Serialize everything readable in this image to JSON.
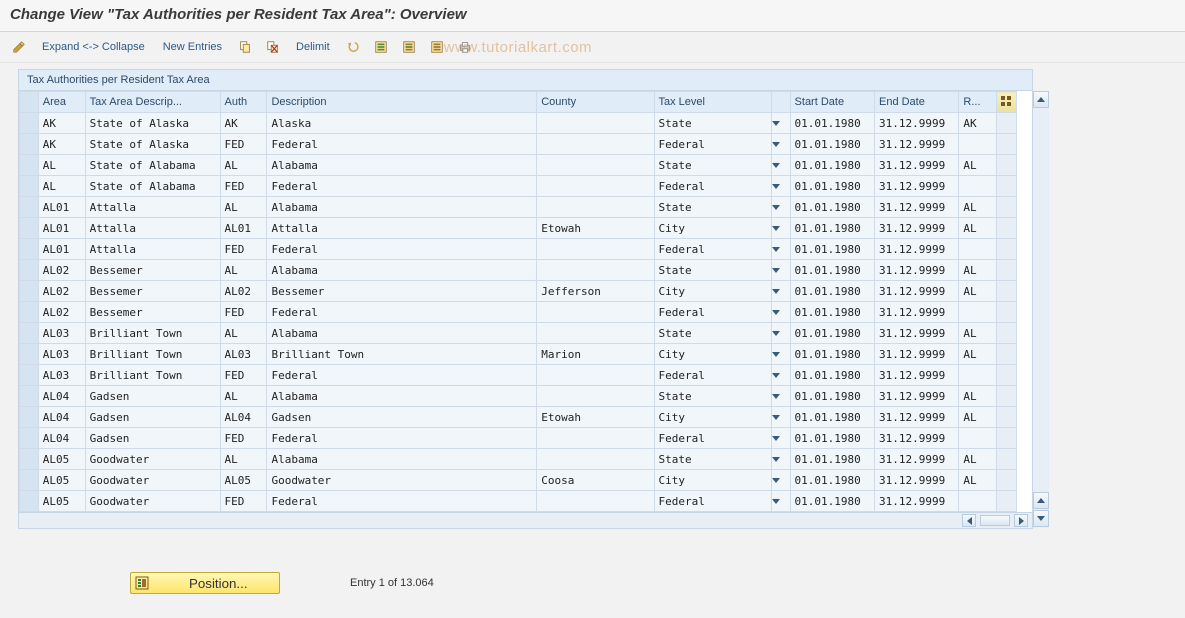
{
  "title": "Change View \"Tax Authorities per Resident Tax Area\": Overview",
  "watermark": "www.tutorialkart.com",
  "toolbar": {
    "expand_collapse": "Expand <-> Collapse",
    "new_entries": "New Entries",
    "delimit": "Delimit"
  },
  "panel": {
    "title": "Tax Authorities per Resident Tax Area"
  },
  "columns": {
    "rowsel": "",
    "area": "Area",
    "desc": "Tax Area Descrip...",
    "auth": "Auth",
    "adesc": "Description",
    "county": "County",
    "taxlevel": "Tax Level",
    "start": "Start Date",
    "end": "End Date",
    "r": "R...",
    "cfg": ""
  },
  "rows": [
    {
      "area": "AK",
      "desc": "State of Alaska",
      "auth": "AK",
      "adesc": "Alaska",
      "county": "",
      "taxlevel": "State",
      "start": "01.01.1980",
      "end": "31.12.9999",
      "r": "AK"
    },
    {
      "area": "AK",
      "desc": "State of Alaska",
      "auth": "FED",
      "adesc": "Federal",
      "county": "",
      "taxlevel": "Federal",
      "start": "01.01.1980",
      "end": "31.12.9999",
      "r": ""
    },
    {
      "area": "AL",
      "desc": "State of Alabama",
      "auth": "AL",
      "adesc": "Alabama",
      "county": "",
      "taxlevel": "State",
      "start": "01.01.1980",
      "end": "31.12.9999",
      "r": "AL"
    },
    {
      "area": "AL",
      "desc": "State of Alabama",
      "auth": "FED",
      "adesc": "Federal",
      "county": "",
      "taxlevel": "Federal",
      "start": "01.01.1980",
      "end": "31.12.9999",
      "r": ""
    },
    {
      "area": "AL01",
      "desc": "Attalla",
      "auth": "AL",
      "adesc": "Alabama",
      "county": "",
      "taxlevel": "State",
      "start": "01.01.1980",
      "end": "31.12.9999",
      "r": "AL"
    },
    {
      "area": "AL01",
      "desc": "Attalla",
      "auth": "AL01",
      "adesc": "Attalla",
      "county": "Etowah",
      "taxlevel": "City",
      "start": "01.01.1980",
      "end": "31.12.9999",
      "r": "AL"
    },
    {
      "area": "AL01",
      "desc": "Attalla",
      "auth": "FED",
      "adesc": "Federal",
      "county": "",
      "taxlevel": "Federal",
      "start": "01.01.1980",
      "end": "31.12.9999",
      "r": ""
    },
    {
      "area": "AL02",
      "desc": "Bessemer",
      "auth": "AL",
      "adesc": "Alabama",
      "county": "",
      "taxlevel": "State",
      "start": "01.01.1980",
      "end": "31.12.9999",
      "r": "AL"
    },
    {
      "area": "AL02",
      "desc": "Bessemer",
      "auth": "AL02",
      "adesc": "Bessemer",
      "county": "Jefferson",
      "taxlevel": "City",
      "start": "01.01.1980",
      "end": "31.12.9999",
      "r": "AL"
    },
    {
      "area": "AL02",
      "desc": "Bessemer",
      "auth": "FED",
      "adesc": "Federal",
      "county": "",
      "taxlevel": "Federal",
      "start": "01.01.1980",
      "end": "31.12.9999",
      "r": ""
    },
    {
      "area": "AL03",
      "desc": "Brilliant Town",
      "auth": "AL",
      "adesc": "Alabama",
      "county": "",
      "taxlevel": "State",
      "start": "01.01.1980",
      "end": "31.12.9999",
      "r": "AL"
    },
    {
      "area": "AL03",
      "desc": "Brilliant Town",
      "auth": "AL03",
      "adesc": "Brilliant Town",
      "county": "Marion",
      "taxlevel": "City",
      "start": "01.01.1980",
      "end": "31.12.9999",
      "r": "AL"
    },
    {
      "area": "AL03",
      "desc": "Brilliant Town",
      "auth": "FED",
      "adesc": "Federal",
      "county": "",
      "taxlevel": "Federal",
      "start": "01.01.1980",
      "end": "31.12.9999",
      "r": ""
    },
    {
      "area": "AL04",
      "desc": "Gadsen",
      "auth": "AL",
      "adesc": "Alabama",
      "county": "",
      "taxlevel": "State",
      "start": "01.01.1980",
      "end": "31.12.9999",
      "r": "AL"
    },
    {
      "area": "AL04",
      "desc": "Gadsen",
      "auth": "AL04",
      "adesc": "Gadsen",
      "county": "Etowah",
      "taxlevel": "City",
      "start": "01.01.1980",
      "end": "31.12.9999",
      "r": "AL"
    },
    {
      "area": "AL04",
      "desc": "Gadsen",
      "auth": "FED",
      "adesc": "Federal",
      "county": "",
      "taxlevel": "Federal",
      "start": "01.01.1980",
      "end": "31.12.9999",
      "r": ""
    },
    {
      "area": "AL05",
      "desc": "Goodwater",
      "auth": "AL",
      "adesc": "Alabama",
      "county": "",
      "taxlevel": "State",
      "start": "01.01.1980",
      "end": "31.12.9999",
      "r": "AL"
    },
    {
      "area": "AL05",
      "desc": "Goodwater",
      "auth": "AL05",
      "adesc": "Goodwater",
      "county": "Coosa",
      "taxlevel": "City",
      "start": "01.01.1980",
      "end": "31.12.9999",
      "r": "AL"
    },
    {
      "area": "AL05",
      "desc": "Goodwater",
      "auth": "FED",
      "adesc": "Federal",
      "county": "",
      "taxlevel": "Federal",
      "start": "01.01.1980",
      "end": "31.12.9999",
      "r": ""
    }
  ],
  "footer": {
    "position_label": "Position...",
    "entry_indicator": "Entry 1 of 13.064"
  }
}
